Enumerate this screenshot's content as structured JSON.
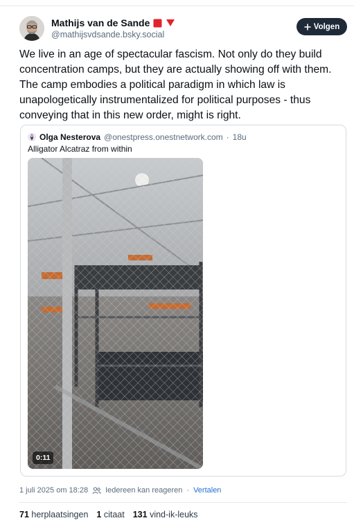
{
  "author": {
    "name": "Mathijs van de Sande",
    "handle": "@mathijsvdsande.bsky.social",
    "badges": [
      "red-square",
      "red-triangle"
    ]
  },
  "follow_button": {
    "label": "Volgen",
    "icon": "plus-icon"
  },
  "post": {
    "text": "We live in an age of spectacular fascism. Not only do they build concentration camps, but they are actually showing off with them. The camp embodies a political paradigm in which law is unapologetically instrumentalized for political purposes - thus conveying that in this new order, might is right."
  },
  "quote": {
    "author_name": "Olga Nesterova",
    "author_handle": "@onestpress.onestnetwork.com",
    "separator": "·",
    "age": "18u",
    "text": "Alligator Alcatraz from within",
    "video_duration": "0:11"
  },
  "meta": {
    "timestamp": "1 juli 2025 om 18:28",
    "reply_setting": "Iedereen kan reageren",
    "separator": "·",
    "translate": "Vertalen"
  },
  "stats": {
    "reposts_count": "71",
    "reposts_label": "herplaatsingen",
    "quotes_count": "1",
    "quotes_label": "citaat",
    "likes_count": "131",
    "likes_label": "vind-ik-leuks"
  },
  "colors": {
    "text": "#0b0f14",
    "muted": "#5b6b7c",
    "link": "#1f6fd1",
    "follow_bg": "#1f2a38",
    "border": "#d4dbe2",
    "badge_red": "#e0242c"
  }
}
